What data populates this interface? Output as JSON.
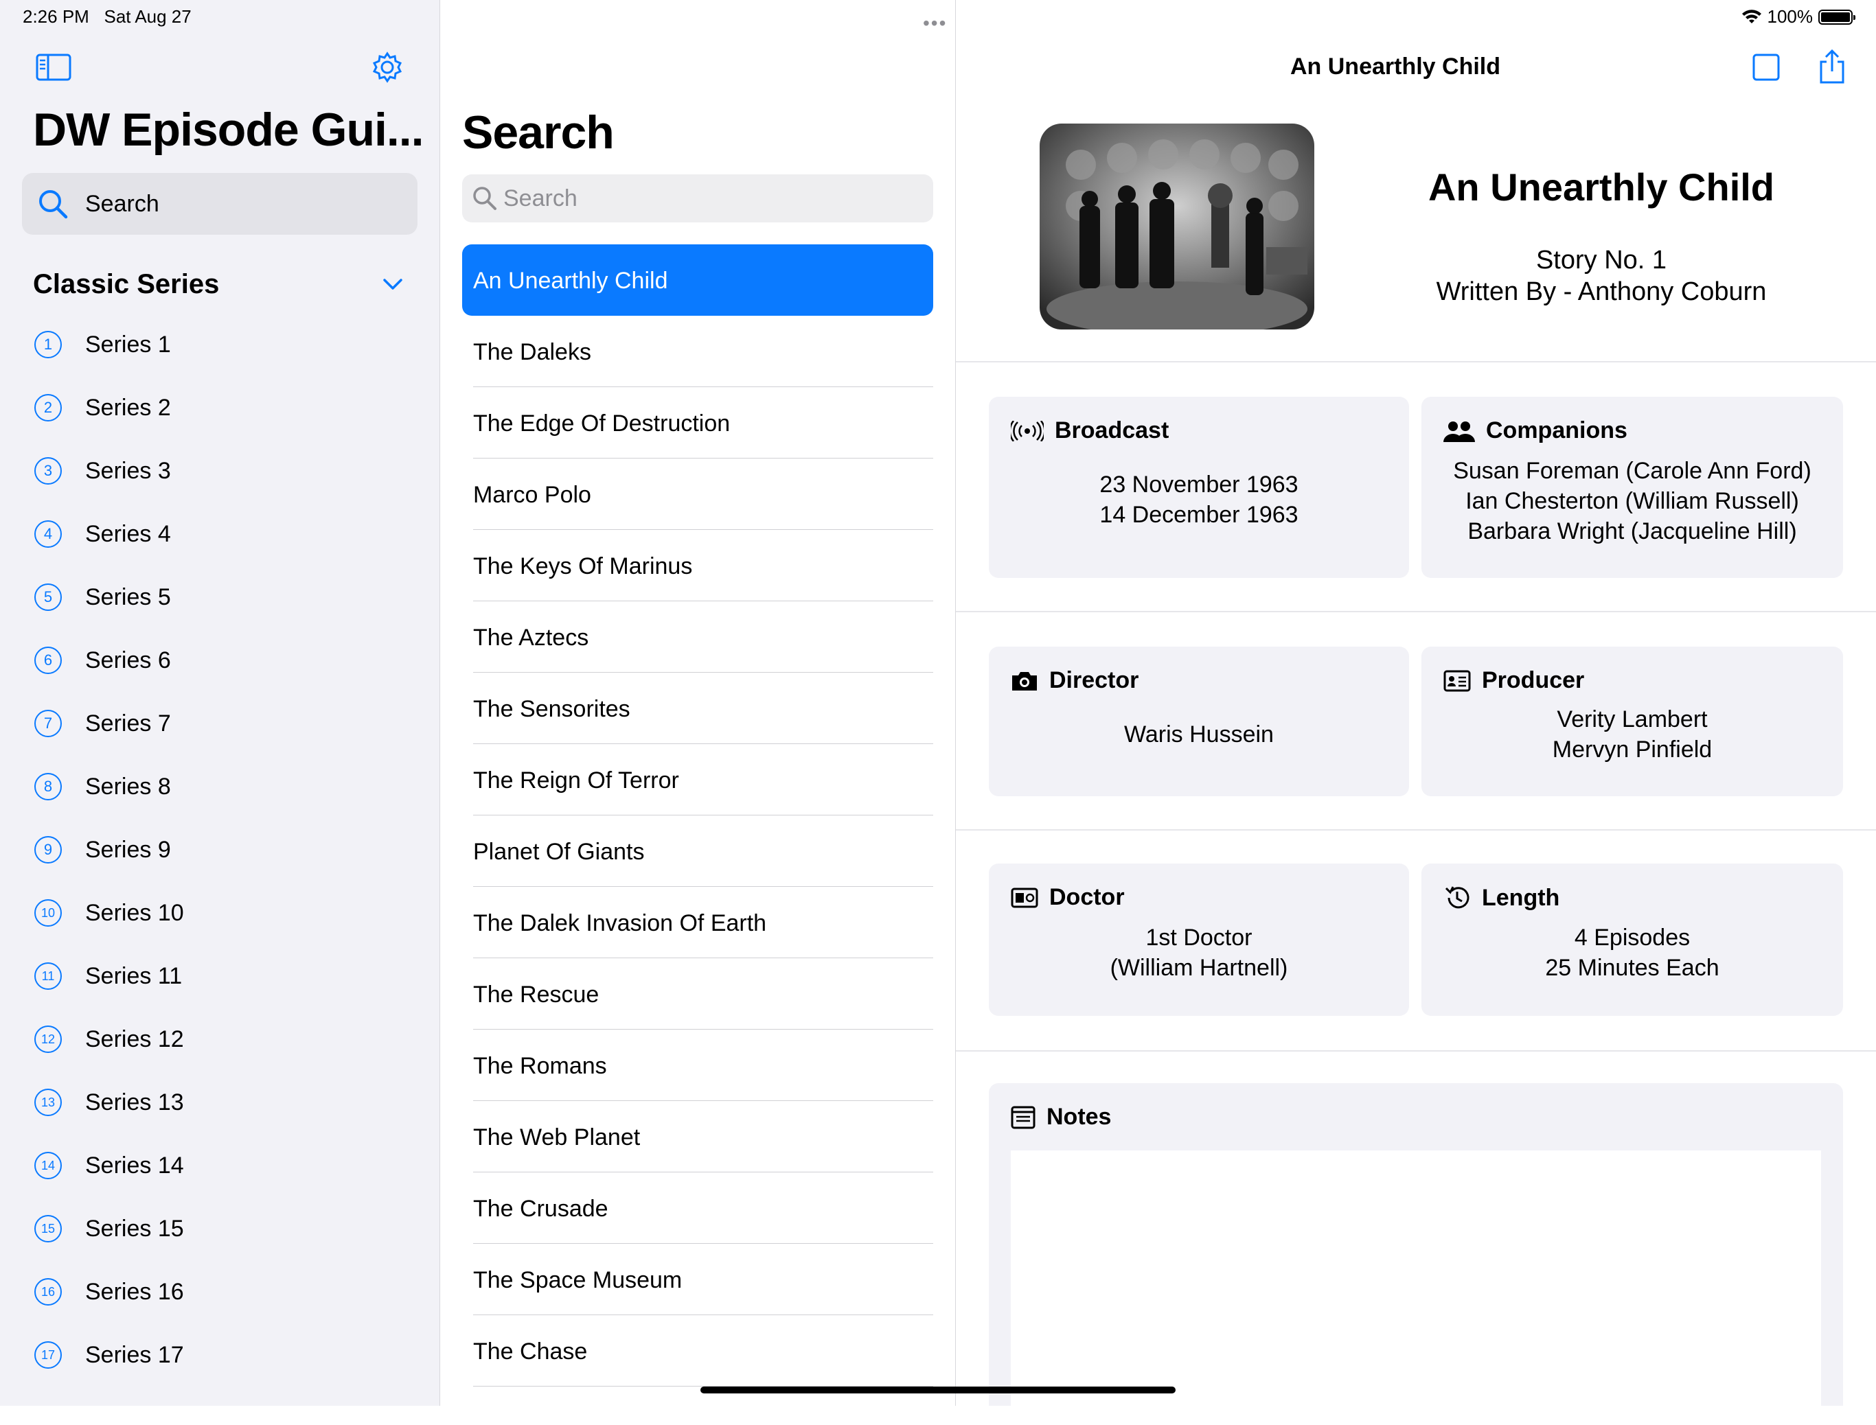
{
  "status": {
    "time": "2:26 PM",
    "date": "Sat Aug 27",
    "battery": "100%"
  },
  "sidebar": {
    "title": "DW Episode Gui...",
    "search_label": "Search",
    "section_title": "Classic Series",
    "series": [
      {
        "num": "1",
        "label": "Series 1"
      },
      {
        "num": "2",
        "label": "Series 2"
      },
      {
        "num": "3",
        "label": "Series 3"
      },
      {
        "num": "4",
        "label": "Series 4"
      },
      {
        "num": "5",
        "label": "Series 5"
      },
      {
        "num": "6",
        "label": "Series 6"
      },
      {
        "num": "7",
        "label": "Series 7"
      },
      {
        "num": "8",
        "label": "Series 8"
      },
      {
        "num": "9",
        "label": "Series 9"
      },
      {
        "num": "10",
        "label": "Series 10"
      },
      {
        "num": "11",
        "label": "Series 11"
      },
      {
        "num": "12",
        "label": "Series 12"
      },
      {
        "num": "13",
        "label": "Series 13"
      },
      {
        "num": "14",
        "label": "Series 14"
      },
      {
        "num": "15",
        "label": "Series 15"
      },
      {
        "num": "16",
        "label": "Series 16"
      },
      {
        "num": "17",
        "label": "Series 17"
      }
    ]
  },
  "middle": {
    "title": "Search",
    "search_placeholder": "Search",
    "episodes": [
      "An Unearthly Child",
      "The Daleks",
      "The Edge Of Destruction",
      "Marco Polo",
      "The Keys Of Marinus",
      "The Aztecs",
      "The Sensorites",
      "The Reign Of Terror",
      "Planet Of Giants",
      "The Dalek Invasion Of Earth",
      "The Rescue",
      "The Romans",
      "The Web Planet",
      "The Crusade",
      "The Space Museum",
      "The Chase"
    ],
    "selected_index": 0
  },
  "detail": {
    "nav_title": "An Unearthly Child",
    "title": "An Unearthly Child",
    "story": "Story No. 1",
    "written_by": "Written By - Anthony Coburn",
    "broadcast": {
      "label": "Broadcast",
      "line1": "23 November 1963",
      "line2": "14 December 1963"
    },
    "companions": {
      "label": "Companions",
      "line1": "Susan Foreman (Carole Ann Ford)",
      "line2": "Ian Chesterton (William Russell)",
      "line3": "Barbara Wright (Jacqueline Hill)"
    },
    "director": {
      "label": "Director",
      "line1": "Waris Hussein"
    },
    "producer": {
      "label": "Producer",
      "line1": "Verity Lambert",
      "line2": "Mervyn Pinfield"
    },
    "doctor": {
      "label": "Doctor",
      "line1": "1st Doctor",
      "line2": "(William Hartnell)"
    },
    "length": {
      "label": "Length",
      "line1": "4 Episodes",
      "line2": "25 Minutes Each"
    },
    "notes": {
      "label": "Notes"
    }
  },
  "colors": {
    "accent": "#0a7aff",
    "sidebar_bg": "#f2f2f7",
    "card_bg": "#f2f2f7"
  }
}
